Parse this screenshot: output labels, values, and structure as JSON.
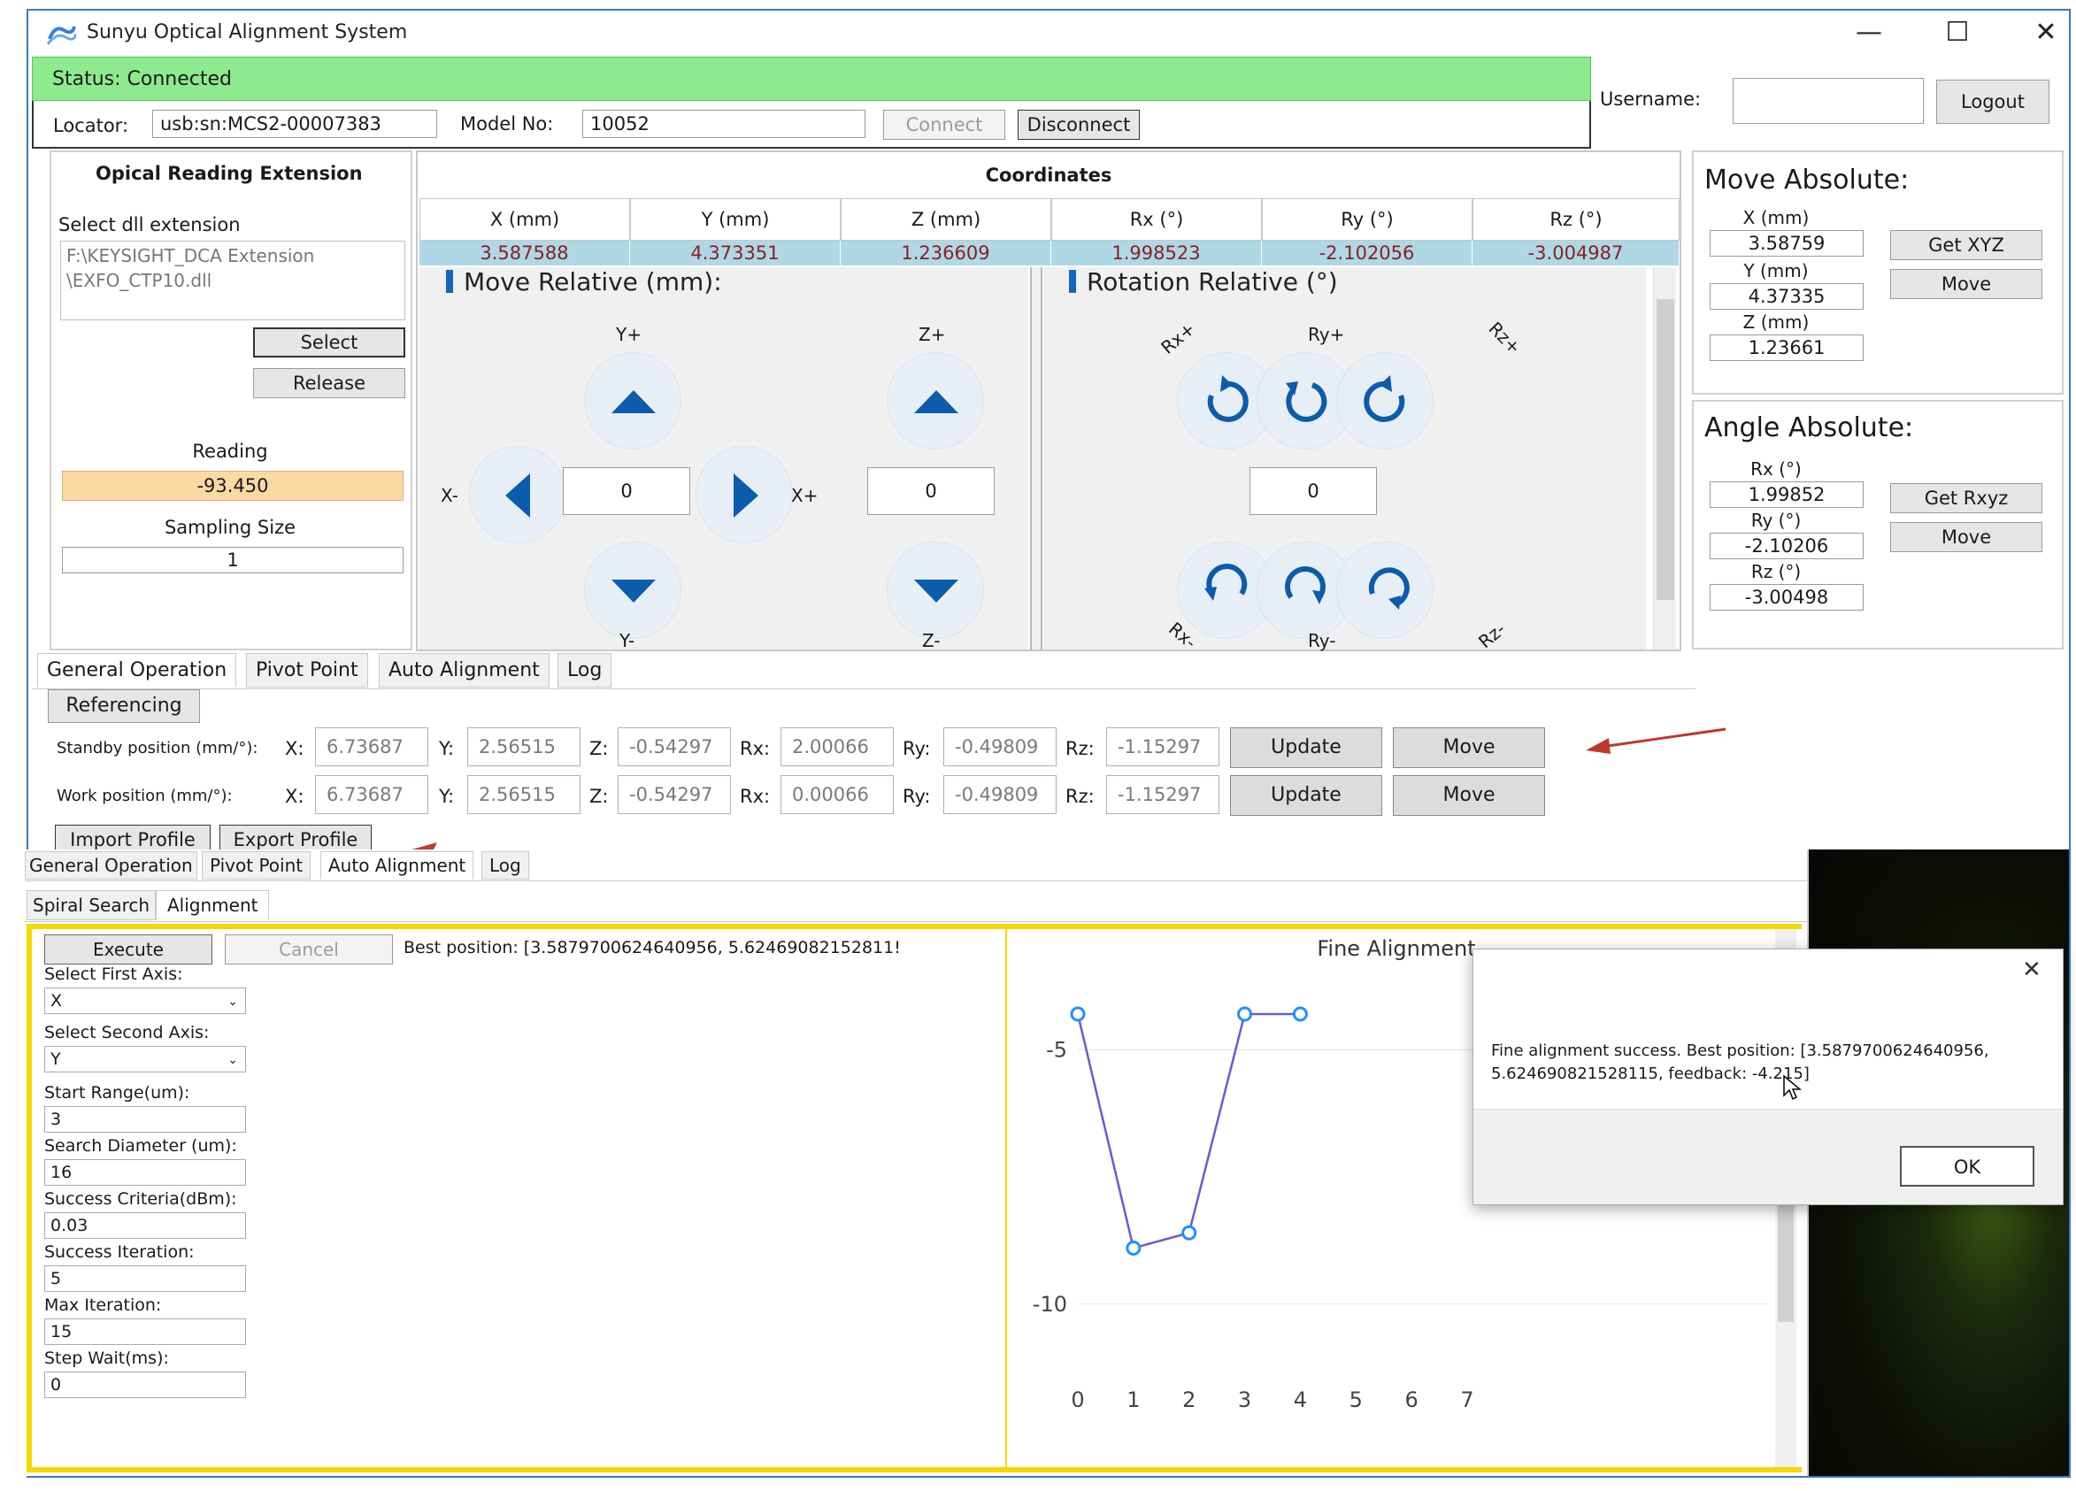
{
  "app": {
    "title": "Sunyu Optical Alignment System"
  },
  "window_controls": {
    "minimize": "—",
    "maximize": "☐",
    "close": "✕"
  },
  "status": {
    "text": "Status: Connected",
    "color": "#8eea8e"
  },
  "connection": {
    "locator_label": "Locator:",
    "locator_value": "usb:sn:MCS2-00007383",
    "model_label": "Model No:",
    "model_value": "10052",
    "connect": "Connect",
    "disconnect": "Disconnect"
  },
  "user": {
    "username_label": "Username:",
    "username_value": "",
    "logout": "Logout"
  },
  "optical": {
    "title": "Opical Reading Extension",
    "select_label": "Select dll extension",
    "path_line1": "F:\\KEYSIGHT_DCA Extension",
    "path_line2": "\\EXFO_CTP10.dll",
    "select_btn": "Select",
    "release_btn": "Release",
    "reading_label": "Reading",
    "reading_value": "-93.450",
    "sampling_label": "Sampling Size",
    "sampling_value": "1"
  },
  "coordinates": {
    "title": "Coordinates",
    "headers": [
      "X (mm)",
      "Y (mm)",
      "Z (mm)",
      "Rx (°)",
      "Ry (°)",
      "Rz (°)"
    ],
    "values": [
      "3.587588",
      "4.373351",
      "1.236609",
      "1.998523",
      "-2.102056",
      "-3.004987"
    ]
  },
  "move_relative": {
    "title": "Move Relative (mm):",
    "yplus": "Y+",
    "yminus": "Y-",
    "xminus": "X-",
    "xplus": "X+",
    "zplus": "Z+",
    "zminus": "Z-",
    "xy_step": "0",
    "z_step": "0"
  },
  "rotation_relative": {
    "title": "Rotation Relative (°)",
    "rx_plus": "Rx+",
    "ry_plus": "Ry+",
    "rz_plus": "Rz+",
    "rx_minus": "Rx-",
    "ry_minus": "Ry-",
    "rz_minus": "Rz-",
    "step": "0"
  },
  "move_absolute": {
    "title": "Move Absolute:",
    "x_label": "X (mm)",
    "x_value": "3.58759",
    "y_label": "Y (mm)",
    "y_value": "4.37335",
    "z_label": "Z (mm)",
    "z_value": "1.23661",
    "get_btn": "Get XYZ",
    "move_btn": "Move"
  },
  "angle_absolute": {
    "title": "Angle Absolute:",
    "rx_label": "Rx (°)",
    "rx_value": "1.99852",
    "ry_label": "Ry (°)",
    "ry_value": "-2.10206",
    "rz_label": "Rz (°)",
    "rz_value": "-3.00498",
    "get_btn": "Get Rxyz",
    "move_btn": "Move"
  },
  "tabs": [
    "General Operation",
    "Pivot Point",
    "Auto Alignment",
    "Log"
  ],
  "general": {
    "referencing": "Referencing",
    "standby_label": "Standby position (mm/°):",
    "work_label": "Work position (mm/°):",
    "axis_labels": [
      "X:",
      "Y:",
      "Z:",
      "Rx:",
      "Ry:",
      "Rz:"
    ],
    "standby_values": [
      "6.73687",
      "2.56515",
      "-0.54297",
      "2.00066",
      "-0.49809",
      "-1.15297"
    ],
    "work_values": [
      "6.73687",
      "2.56515",
      "-0.54297",
      "0.00066",
      "-0.49809",
      "-1.15297"
    ],
    "update": "Update",
    "move": "Move",
    "import": "Import Profile",
    "export": "Export Profile"
  },
  "overlay": {
    "tabs": [
      "General Operation",
      "Pivot Point",
      "Auto Alignment",
      "Log"
    ],
    "subtabs": [
      "Spiral Search",
      "Alignment"
    ],
    "execute": "Execute",
    "cancel": "Cancel",
    "best_position": "Best position: [3.5879700624640956, 5.62469082152811!",
    "first_axis_label": "Select First Axis:",
    "first_axis_value": "X",
    "second_axis_label": "Select Second Axis:",
    "second_axis_value": "Y",
    "start_range_label": "Start Range(um):",
    "start_range_value": "3",
    "search_diameter_label": "Search Diameter (um):",
    "search_diameter_value": "16",
    "success_criteria_label": "Success Criteria(dBm):",
    "success_criteria_value": "0.03",
    "success_iteration_label": "Success Iteration:",
    "success_iteration_value": "5",
    "max_iteration_label": "Max Iteration:",
    "max_iteration_value": "15",
    "step_wait_label": "Step Wait(ms):",
    "step_wait_value": "0"
  },
  "chart_data": {
    "type": "line",
    "title": "Fine Alignment",
    "x": [
      0,
      1,
      2,
      3,
      4
    ],
    "values": [
      -4.3,
      -8.9,
      -8.6,
      -4.3,
      -4.3
    ],
    "x_ticks": [
      "0",
      "1",
      "2",
      "3",
      "4",
      "5",
      "6",
      "7"
    ],
    "y_ticks": [
      "-5",
      "-10"
    ],
    "xlim": [
      0,
      7
    ],
    "ylim": [
      -11.5,
      -3.5
    ],
    "line_color": "#6a5acd",
    "point_color": "#1e90ff"
  },
  "dialog": {
    "close": "✕",
    "message_line1": "Fine alignment success. Best position: [3.5879700624640956,",
    "message_line2": "5.624690821528115, feedback: -4.215]",
    "ok": "OK"
  }
}
